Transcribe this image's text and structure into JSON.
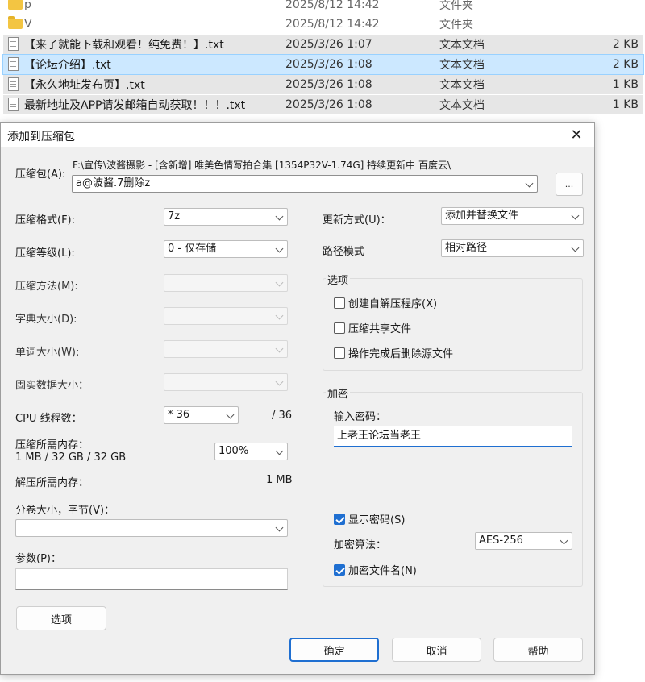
{
  "files": [
    {
      "kind": "folder",
      "name": "p",
      "date": "2025/8/12 14:42",
      "type": "文件夹",
      "size": "",
      "state": "none"
    },
    {
      "kind": "folder",
      "name": "V",
      "date": "2025/8/12 14:42",
      "type": "文件夹",
      "size": "",
      "state": "none"
    },
    {
      "kind": "doc",
      "name": "【来了就能下载和观看！纯免费！】.txt",
      "date": "2025/3/26 1:07",
      "type": "文本文档",
      "size": "2 KB",
      "state": "selected"
    },
    {
      "kind": "doc",
      "name": "【论坛介绍】.txt",
      "date": "2025/3/26 1:08",
      "type": "文本文档",
      "size": "2 KB",
      "state": "focused"
    },
    {
      "kind": "doc",
      "name": "【永久地址发布页】.txt",
      "date": "2025/3/26 1:08",
      "type": "文本文档",
      "size": "1 KB",
      "state": "selected"
    },
    {
      "kind": "doc",
      "name": "最新地址及APP请发邮箱自动获取！！！.txt",
      "date": "2025/3/26 1:08",
      "type": "文本文档",
      "size": "1 KB",
      "state": "selected"
    }
  ],
  "dialog": {
    "title": "添加到压缩包",
    "archive_label": "压缩包(A):",
    "archive_path": "F:\\宣传\\波酱摄影 - [含新增] 唯美色情写拍合集 [1354P32V-1.74G] 持续更新中 百度云\\",
    "archive_name": "a@波酱.7删除z",
    "browse_label": "...",
    "format_label": "压缩格式(F):",
    "format_value": "7z",
    "level_label": "压缩等级(L):",
    "level_value": "0 - 仅存储",
    "method_label": "压缩方法(M):",
    "dict_label": "字典大小(D):",
    "word_label": "单词大小(W):",
    "solid_label": "固实数据大小：",
    "cpu_label": "CPU 线程数：",
    "cpu_value": "* 36",
    "cpu_total": "/ 36",
    "mem_label": "压缩所需内存：",
    "mem_value": "1 MB / 32 GB / 32 GB",
    "mem_percent": "100%",
    "decomp_label": "解压所需内存：",
    "decomp_value": "1 MB",
    "split_label": "分卷大小，字节(V)：",
    "split_value": "",
    "params_label": "参数(P)：",
    "params_value": "",
    "options_button": "选项",
    "update_label": "更新方式(U)：",
    "update_value": "添加并替换文件",
    "path_label": "路径模式",
    "path_value": "相对路径",
    "options_group": "选项",
    "opt_sfx": "创建自解压程序(X)",
    "opt_shared": "压缩共享文件",
    "opt_delete": "操作完成后删除源文件",
    "enc_group": "加密",
    "pwd_label": "输入密码：",
    "pwd_value": "上老王论坛当老王",
    "show_pwd": "显示密码(S)",
    "algo_label": "加密算法：",
    "algo_value": "AES-256",
    "enc_names": "加密文件名(N)",
    "ok": "确定",
    "cancel": "取消",
    "help": "帮助"
  },
  "icons": {
    "folder": "folder-icon",
    "doc": "text-file-icon",
    "close": "close-icon",
    "dropdown": "chevron-down-icon"
  },
  "colors": {
    "accent": "#1f6fd1",
    "selection": "#cce8ff",
    "folder": "#f3c542"
  }
}
